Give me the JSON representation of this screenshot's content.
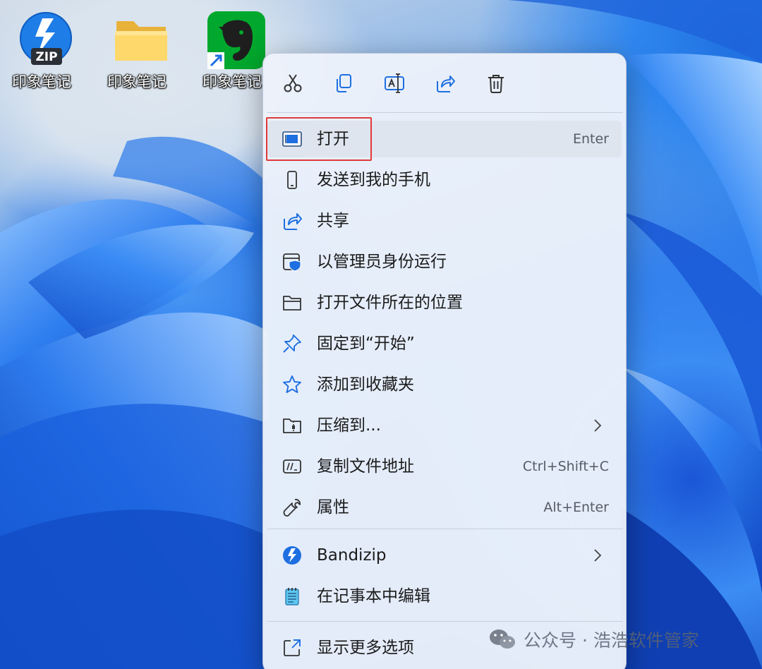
{
  "desktop": {
    "icons": [
      {
        "label": "印象笔记",
        "badge": "ZIP",
        "icon": "bandizip-zip-icon"
      },
      {
        "label": "印象笔记",
        "icon": "folder-icon"
      },
      {
        "label": "印象笔记",
        "icon": "evernote-shortcut-icon"
      }
    ]
  },
  "context_menu": {
    "toolbar": [
      {
        "name": "cut",
        "icon": "scissors-icon"
      },
      {
        "name": "copy",
        "icon": "copy-icon"
      },
      {
        "name": "rename",
        "icon": "rename-icon"
      },
      {
        "name": "share",
        "icon": "share-icon"
      },
      {
        "name": "delete",
        "icon": "trash-icon"
      }
    ],
    "items": [
      {
        "label": "打开",
        "shortcut": "Enter",
        "icon": "open-window-icon",
        "highlighted": true
      },
      {
        "label": "发送到我的手机",
        "shortcut": "",
        "icon": "phone-icon"
      },
      {
        "label": "共享",
        "shortcut": "",
        "icon": "share-icon"
      },
      {
        "label": "以管理员身份运行",
        "shortcut": "",
        "icon": "admin-shield-icon"
      },
      {
        "label": "打开文件所在的位置",
        "shortcut": "",
        "icon": "folder-icon"
      },
      {
        "label": "固定到“开始”",
        "shortcut": "",
        "icon": "pin-icon"
      },
      {
        "label": "添加到收藏夹",
        "shortcut": "",
        "icon": "star-icon"
      },
      {
        "label": "压缩到...",
        "shortcut": "",
        "icon": "zip-folder-icon",
        "submenu": true
      },
      {
        "label": "复制文件地址",
        "shortcut": "Ctrl+Shift+C",
        "icon": "copy-path-icon"
      },
      {
        "label": "属性",
        "shortcut": "Alt+Enter",
        "icon": "wrench-icon"
      },
      {
        "label": "Bandizip",
        "shortcut": "",
        "icon": "bandizip-icon",
        "submenu": true
      },
      {
        "label": "在记事本中编辑",
        "shortcut": "",
        "icon": "notepad-icon"
      },
      {
        "label": "显示更多选项",
        "shortcut": "",
        "icon": "more-options-icon"
      }
    ]
  },
  "watermark": {
    "text": "公众号 · 浩浩软件管家",
    "icon": "wechat-icon"
  },
  "colors": {
    "highlight_border": "#e03a3a",
    "accent_blue": "#1e6fe0"
  }
}
